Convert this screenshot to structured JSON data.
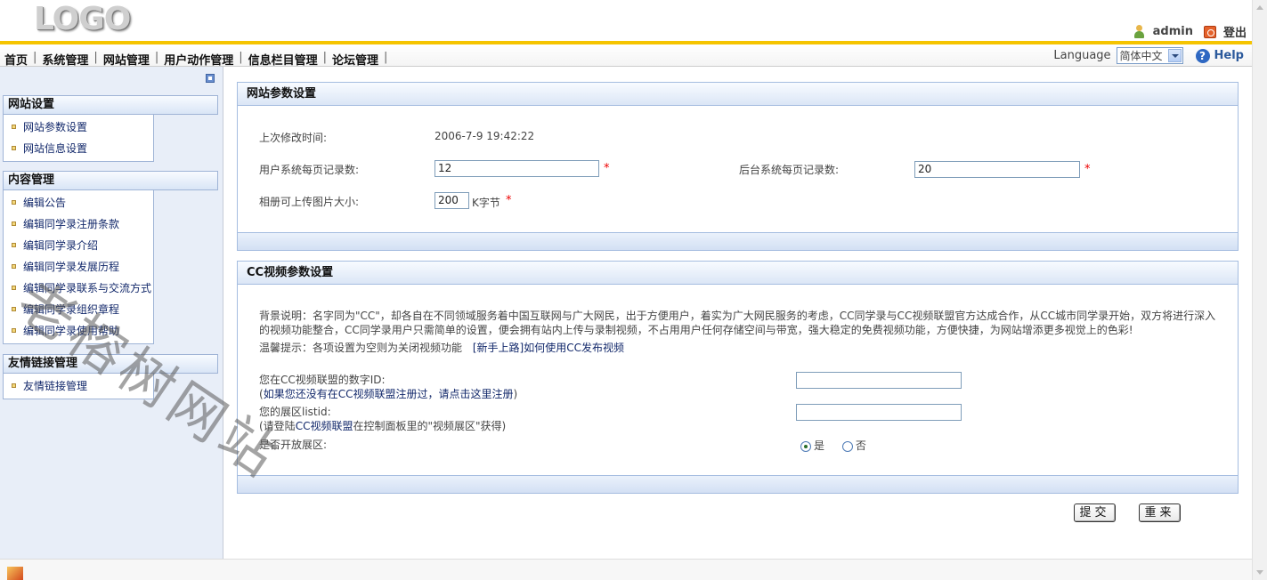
{
  "header": {
    "logo_text": "LOGO",
    "admin_name": "admin",
    "logout_label": "登出"
  },
  "menu": {
    "items": [
      "首页",
      "系统管理",
      "网站管理",
      "用户动作管理",
      "信息栏目管理",
      "论坛管理"
    ],
    "separator": "|",
    "language_label": "Language",
    "language_value": "简体中文",
    "help_label": "Help"
  },
  "sidebar": {
    "groups": [
      {
        "title": "网站设置",
        "items": [
          "网站参数设置",
          "网站信息设置"
        ]
      },
      {
        "title": "内容管理",
        "items": [
          "编辑公告",
          "编辑同学录注册条款",
          "编辑同学录介绍",
          "编辑同学录发展历程",
          "编辑同学录联系与交流方式",
          "编辑同学录组织章程",
          "编辑同学录使用帮助"
        ]
      },
      {
        "title": "友情链接管理",
        "items": [
          "友情链接管理"
        ]
      }
    ]
  },
  "site_params": {
    "title": "网站参数设置",
    "last_modified_label": "上次修改时间:",
    "last_modified_value": "2006-7-9 19:42:22",
    "user_page_records_label": "用户系统每页记录数:",
    "user_page_records_value": "12",
    "admin_page_records_label": "后台系统每页记录数:",
    "admin_page_records_value": "20",
    "album_upload_size_label": "相册可上传图片大小:",
    "album_upload_size_value": "200",
    "album_upload_size_unit": "K字节",
    "required_mark": "*"
  },
  "cc_video": {
    "title": "CC视频参数设置",
    "background_text": "背景说明：名字同为\"CC\"，却各自在不同领域服务着中国互联网与广大网民，出于方便用户，着实为广大网民服务的考虑，CC同学录与CC视频联盟官方达成合作，从CC城市同学录开始，双方将进行深入的视频功能整合，CC同学录用户只需简单的设置，便会拥有站内上传与录制视频，不占用用户任何存储空间与带宽，强大稳定的免费视频功能，方便快捷，为网站增添更多视觉上的色彩!",
    "tip_text": "温馨提示：各项设置为空则为关闭视频功能",
    "tip_link": "[新手上路]如何使用CC发布视频",
    "account_label": "您在CC视频联盟的数字ID:",
    "account_hint_prefix": "(",
    "account_hint_link": "如果您还没有在CC视频联盟注册过，请点击这里注册",
    "account_hint_suffix": ")",
    "account_value": "",
    "listid_label": "您的展区listid:",
    "listid_hint_prefix": "(请登陆",
    "listid_hint_link": "CC视频联盟",
    "listid_hint_suffix": "在控制面板里的\"视频展区\"获得)",
    "listid_value": "",
    "open_label": "是否开放展区:",
    "open_yes": "是",
    "open_no": "否",
    "open_selected": "是"
  },
  "actions": {
    "submit": "提交",
    "reset": "重来"
  },
  "watermark": "老榕树网站"
}
